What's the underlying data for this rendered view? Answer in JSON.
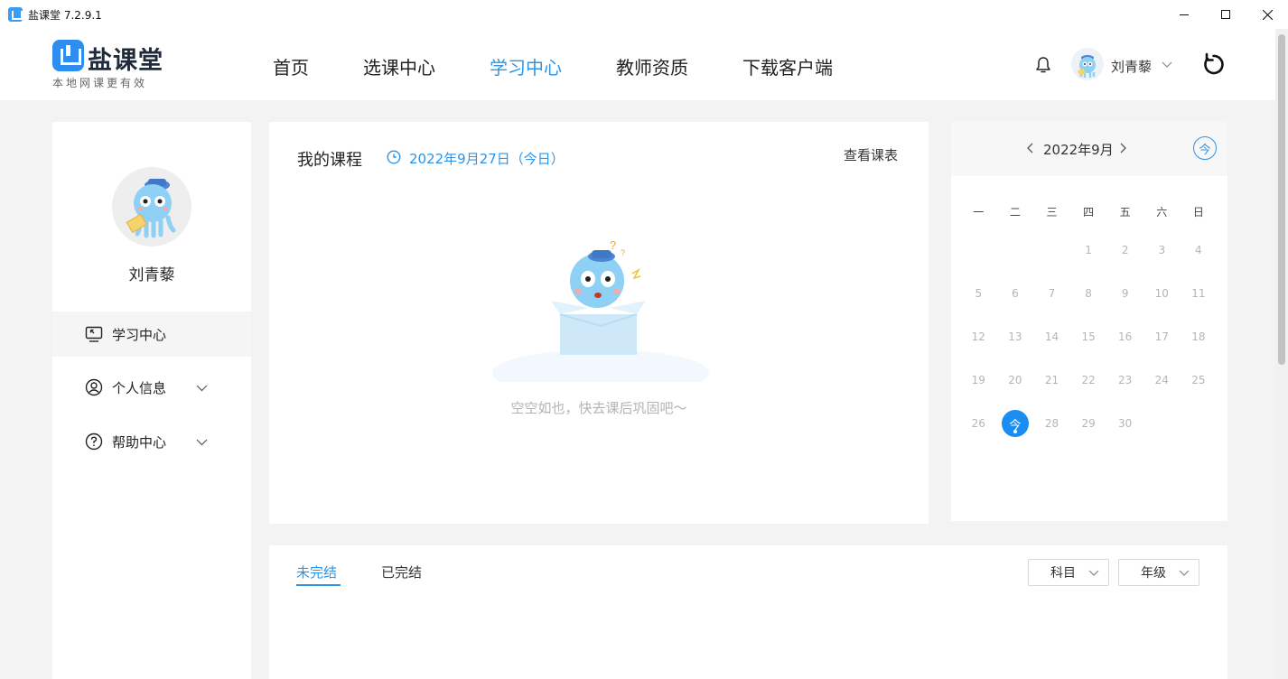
{
  "window": {
    "title": "盐课堂 7.2.9.1"
  },
  "header": {
    "logo_name": "盐课堂",
    "logo_slogan": "本地网课更有效",
    "nav": [
      {
        "label": "首页",
        "active": false
      },
      {
        "label": "选课中心",
        "active": false
      },
      {
        "label": "学习中心",
        "active": true
      },
      {
        "label": "教师资质",
        "active": false
      },
      {
        "label": "下载客户端",
        "active": false
      }
    ],
    "user_name": "刘青藜"
  },
  "sidebar": {
    "profile_name": "刘青藜",
    "menu": [
      {
        "label": "学习中心",
        "icon": "monitor-icon",
        "active": true
      },
      {
        "label": "个人信息",
        "icon": "user-circle-icon",
        "active": false
      },
      {
        "label": "帮助中心",
        "icon": "question-circle-icon",
        "active": false
      }
    ]
  },
  "course": {
    "title": "我的课程",
    "date": "2022年9月27日（今日）",
    "view_schedule": "查看课表",
    "empty_text": "空空如也，快去课后巩固吧～"
  },
  "calendar": {
    "month_label": "2022年9月",
    "today_button": "今",
    "weekdays": [
      "一",
      "二",
      "三",
      "四",
      "五",
      "六",
      "日"
    ],
    "leading_blanks": 3,
    "days": [
      "1",
      "2",
      "3",
      "4",
      "5",
      "6",
      "7",
      "8",
      "9",
      "10",
      "11",
      "12",
      "13",
      "14",
      "15",
      "16",
      "17",
      "18",
      "19",
      "20",
      "21",
      "22",
      "23",
      "24",
      "25",
      "26",
      "今",
      "28",
      "29",
      "30"
    ],
    "today_index": 26
  },
  "bottom": {
    "tabs": [
      {
        "label": "未完结",
        "active": true
      },
      {
        "label": "已完结",
        "active": false
      }
    ],
    "filters": [
      {
        "label": "科目"
      },
      {
        "label": "年级"
      }
    ]
  },
  "colors": {
    "accent": "#2d94e6",
    "today": "#1a8df2",
    "background": "#f3f3f3"
  }
}
